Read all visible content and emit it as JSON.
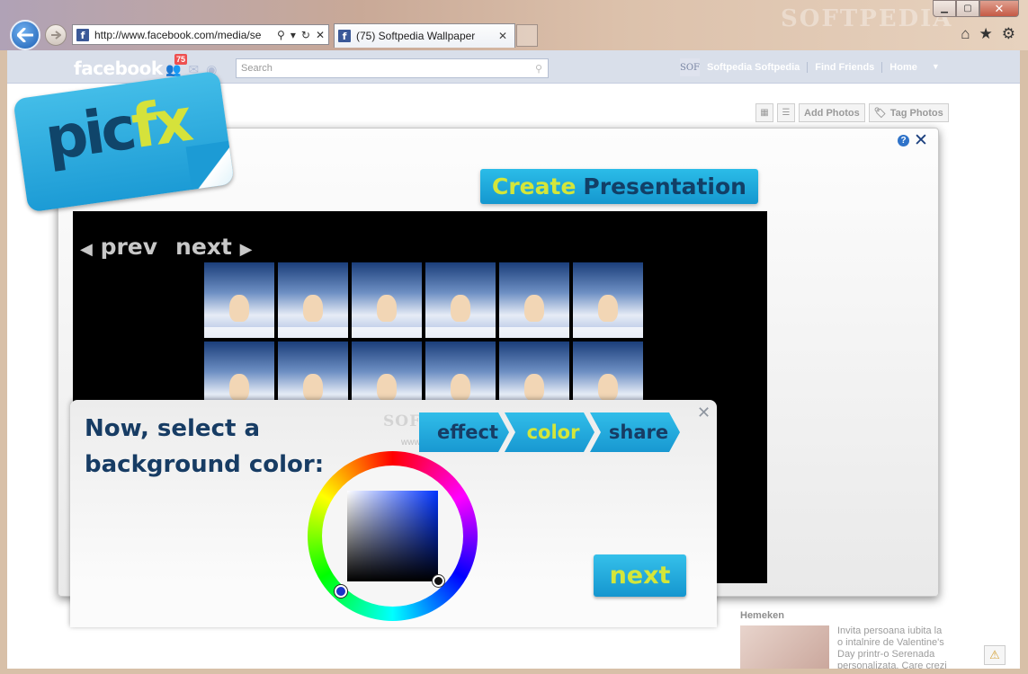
{
  "browser": {
    "url": "http://www.facebook.com/media/se",
    "tab_title": "(75) Softpedia Wallpaper",
    "watermark": "SOFTPEDIA",
    "window_controls": [
      "minimize",
      "maximize",
      "close"
    ],
    "icons": [
      "home-icon",
      "star-icon",
      "gear-icon"
    ]
  },
  "facebook": {
    "logo": "facebook",
    "notification_count": "75",
    "search_placeholder": "Search",
    "avatar_text": "SOF",
    "nav_links": [
      "Softpedia Softpedia",
      "Find Friends",
      "Home"
    ],
    "photo_actions": {
      "add_photos": "Add Photos",
      "tag_photos": "Tag Photos"
    },
    "sidebar": {
      "title": "Hemeken",
      "text": "Invita persoana iubita la o intalnire de Valentine's Day printr-o Serenada personalizata. Care crezi"
    }
  },
  "picfx": {
    "logo_pic": "pic",
    "logo_fx": "fx",
    "create_word1": "Create",
    "create_word2": "Presentation",
    "prev_label": "prev",
    "next_nav_label": "next",
    "tile_count": 12,
    "panel": {
      "title": "Now, select a background color:",
      "steps": [
        {
          "label": "effect",
          "active": false
        },
        {
          "label": "color",
          "active": true
        },
        {
          "label": "share",
          "active": false
        }
      ],
      "watermark": "SOFTPEDIA",
      "watermark_sub": "www.softpedia.com",
      "next_label": "next",
      "selected_hue_color": "#1a33c8"
    },
    "colors": {
      "accent_blue": "#1c9bd5",
      "accent_lime": "#d4e63a",
      "navy": "#173c64"
    }
  }
}
